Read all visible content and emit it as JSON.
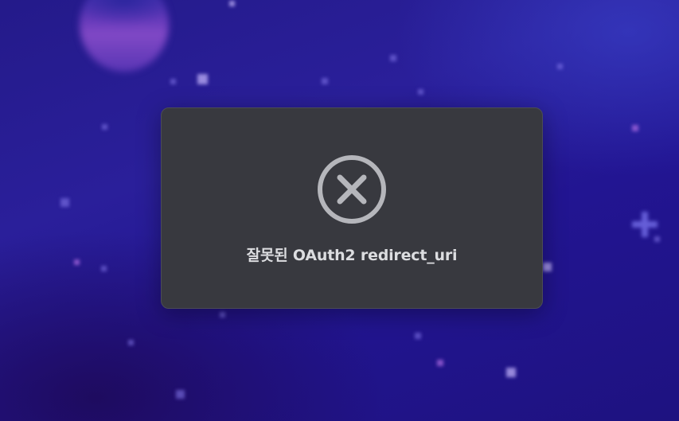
{
  "dialog": {
    "message": "잘못된 OAuth2 redirect_uri",
    "icon": "error-circle-x-icon",
    "icon_color": "#b5b6bb",
    "background": "#38393f"
  },
  "background": {
    "gradient_start": "#241a8a",
    "gradient_end": "#1e1280"
  }
}
